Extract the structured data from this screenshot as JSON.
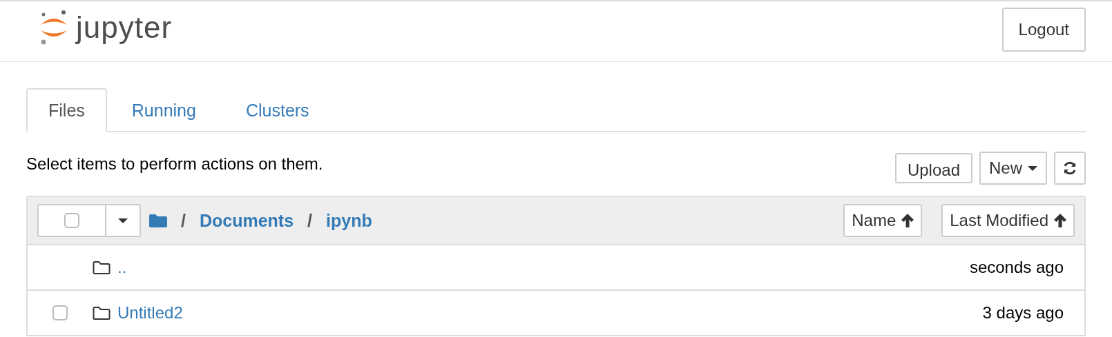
{
  "header": {
    "logo_text": "jupyter",
    "logout_button": "Logout"
  },
  "tabs": [
    {
      "label": "Files",
      "selected": true
    },
    {
      "label": "Running",
      "selected": false
    },
    {
      "label": "Clusters",
      "selected": false
    }
  ],
  "toolbar": {
    "hint": "Select items to perform actions on them.",
    "upload_button": "Upload",
    "new_button": "New"
  },
  "file_list": {
    "select_all": {
      "checked": false
    },
    "breadcrumb": [
      {
        "label": "/",
        "kind": "separator"
      },
      {
        "label": "Documents",
        "kind": "link"
      },
      {
        "label": "/",
        "kind": "separator"
      },
      {
        "label": "ipynb",
        "kind": "link"
      }
    ],
    "sort_buttons": [
      "Name",
      "Last Modified"
    ],
    "rows": [
      {
        "kind": "parent",
        "name": "..",
        "modified": "seconds ago"
      },
      {
        "kind": "folder",
        "name": "Untitled2",
        "modified": "3 days ago",
        "checked": false
      }
    ]
  }
}
